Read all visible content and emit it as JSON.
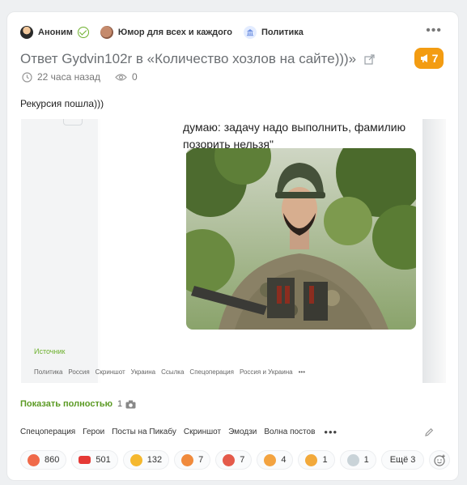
{
  "header": {
    "author": "Аноним",
    "community": "Юмор для всех и каждого",
    "category": "Политика"
  },
  "post": {
    "title": "Ответ Gydvin102r в «Количество хозлов на сайте)))»",
    "rating": "7",
    "time": "22 часа назад",
    "views": "0",
    "text": "Рекурсия пошла)))"
  },
  "embed": {
    "quote_line1": "думаю: задачу надо выполнить, фамилию",
    "quote_line2": "позорить нельзя\"",
    "source_label": "Источник",
    "tags": [
      "Политика",
      "Россия",
      "Скриншот",
      "Украина",
      "Ссылка",
      "Спецоперация",
      "Россия и Украина",
      "•••"
    ]
  },
  "expand": {
    "label": "Показать полностью",
    "count": "1"
  },
  "tags": [
    "Спецоперация",
    "Герои",
    "Посты на Пикабу",
    "Скриншот",
    "Эмодзи",
    "Волна постов"
  ],
  "reactions": [
    {
      "icon": "clown-emoji-icon",
      "count": "860",
      "color": "#f06a4a"
    },
    {
      "icon": "hundred-emoji-icon",
      "count": "501",
      "color": "#e53935"
    },
    {
      "icon": "laughing-emoji-icon",
      "count": "132",
      "color": "#f5b82e"
    },
    {
      "icon": "angry-emoji-icon",
      "count": "7",
      "color": "#f08a3c"
    },
    {
      "icon": "rooster-emoji-icon",
      "count": "7",
      "color": "#e45a4a"
    },
    {
      "icon": "facepalm-emoji-icon",
      "count": "4",
      "color": "#f3a340"
    },
    {
      "icon": "clap-emoji-icon",
      "count": "1",
      "color": "#f2a93b"
    },
    {
      "icon": "dove-emoji-icon",
      "count": "1",
      "color": "#c9d3d8"
    }
  ],
  "reactions_more": "Ещё 3",
  "colors": {
    "accent_green": "#5b9a23",
    "rating_orange": "#f39c12"
  }
}
